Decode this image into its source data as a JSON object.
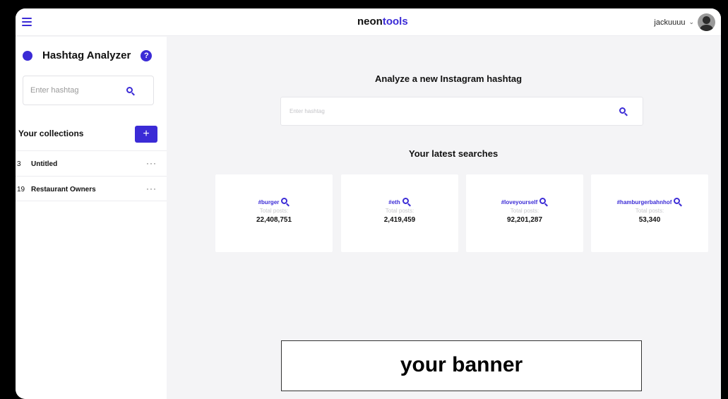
{
  "header": {
    "logo_a": "neon",
    "logo_b": "tools",
    "username": "jackuuuu"
  },
  "sidebar": {
    "title": "Hashtag Analyzer",
    "search_placeholder": "Enter hashtag",
    "collections_label": "Your collections",
    "add_label": "+",
    "collections": [
      {
        "count": "3",
        "name": "Untitled"
      },
      {
        "count": "19",
        "name": "Restaurant Owners"
      }
    ]
  },
  "main": {
    "title": "Analyze a new Instagram hashtag",
    "search_placeholder": "Enter hashtag",
    "latest_title": "Your latest searches",
    "cards": [
      {
        "tag": "#burger",
        "label": "Total posts:",
        "value": "22,408,751"
      },
      {
        "tag": "#eth",
        "label": "Total posts:",
        "value": "2,419,459"
      },
      {
        "tag": "#loveyourself",
        "label": "Total posts:",
        "value": "92,201,287"
      },
      {
        "tag": "#hamburgerbahnhof",
        "label": "Total posts:",
        "value": "53,340"
      }
    ],
    "banner": "your banner"
  },
  "colors": {
    "accent": "#3b2bd6",
    "background": "#f4f4f6"
  }
}
